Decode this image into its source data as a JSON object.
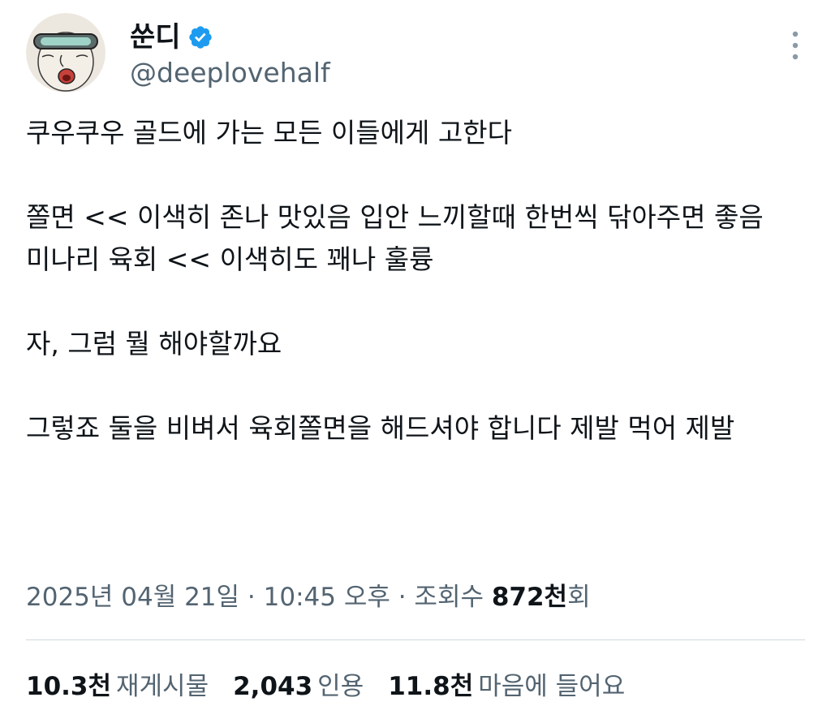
{
  "author": {
    "display_name": "쑨디",
    "handle": "@deeplovehalf",
    "verified": true,
    "avatar_icon": "cartoon-face-visor-avatar"
  },
  "menu_icon": "more-vertical-icon",
  "tweet": {
    "text": "쿠우쿠우 골드에 가는 모든 이들에게 고한다\n\n쫄면 << 이색히 존나 맛있음 입안 느끼할때 한번씩 닦아주면 좋음\n미나리 육회 << 이색히도 꽤나 훌륭\n\n자, 그럼 뭘 해야할까요\n\n그렇죠 둘을 비벼서 육회쫄면을 해드셔야 합니다 제발 먹어 제발"
  },
  "meta": {
    "date": "2025년 04월 21일",
    "sep1": " · ",
    "time": "10:45 오후",
    "sep2": " · ",
    "views_label": "조회수 ",
    "views_count": "872천",
    "views_suffix": "회"
  },
  "stats": {
    "retweets_count": "10.3천",
    "retweets_label": "재게시물",
    "quotes_count": "2,043",
    "quotes_label": "인용",
    "likes_count": "11.8천",
    "likes_label": "마음에 들어요"
  },
  "colors": {
    "text_primary": "#0f1419",
    "text_secondary": "#536471",
    "verified_blue": "#1d9bf0",
    "divider": "#cfd9de"
  }
}
